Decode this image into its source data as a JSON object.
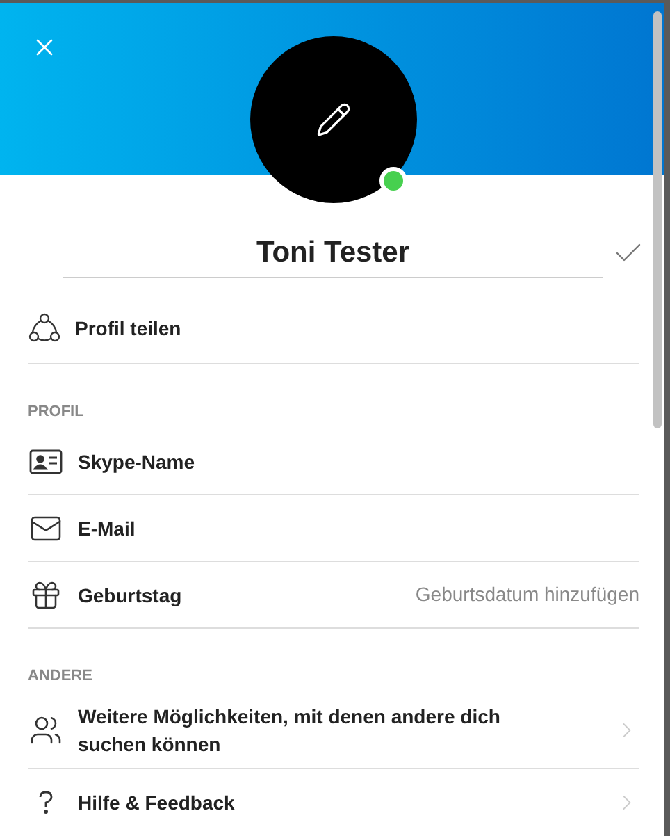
{
  "profile": {
    "name": "Toni Tester",
    "online": true
  },
  "share": {
    "label": "Profil teilen"
  },
  "sections": [
    {
      "title": "PROFIL",
      "items": [
        {
          "kind": "id",
          "label": "Skype-Name"
        },
        {
          "kind": "mail",
          "label": "E-Mail"
        },
        {
          "kind": "gift",
          "label": "Geburtstag",
          "value": "Geburtsdatum hinzufügen"
        }
      ]
    },
    {
      "title": "ANDERE",
      "items": [
        {
          "kind": "people",
          "label": "Weitere Möglichkeiten, mit denen andere dich suchen können",
          "chevron": true
        },
        {
          "kind": "help",
          "label": "Hilfe & Feedback",
          "chevron": true
        }
      ]
    }
  ]
}
